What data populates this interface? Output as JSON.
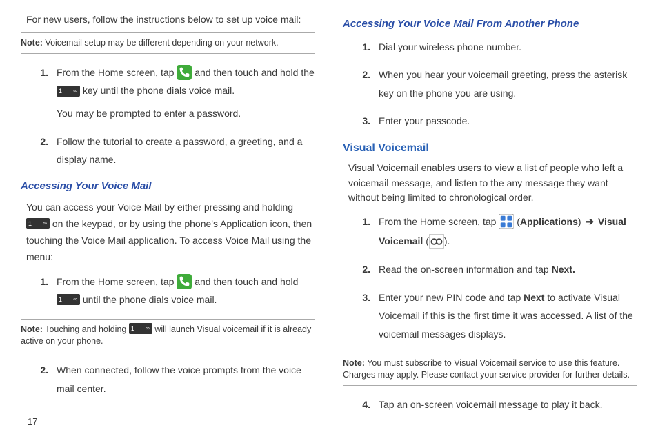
{
  "pageNumber": "17",
  "left": {
    "intro": "For new users, follow the instructions below to set up voice mail:",
    "note1": {
      "label": "Note:",
      "text": " Voicemail setup may be different depending on your network."
    },
    "setup": {
      "s1a": "From the Home screen, tap ",
      "s1b": " and then touch and hold the ",
      "s1c": " key until the phone dials voice mail.",
      "s1sub": "You may be prompted to enter a password.",
      "s2": "Follow the tutorial to create a password, a greeting, and a display name."
    },
    "accessHeading": "Accessing Your Voice Mail",
    "accessPara_a": "You can access your Voice Mail by either pressing and holding ",
    "accessPara_b": " on the keypad, or by using the phone's Application icon, then touching the Voice Mail application. To access Voice Mail using the menu:",
    "access": {
      "s1a": "From the Home screen, tap ",
      "s1b": " and then touch and hold ",
      "s1c": " until the phone dials voice mail."
    },
    "note2": {
      "label": "Note:",
      "text_a": " Touching and holding ",
      "text_b": " will launch Visual voicemail if it is already active on your phone."
    },
    "access2": "When connected, follow the voice prompts from the voice mail center."
  },
  "right": {
    "anotherHeading": "Accessing Your Voice Mail From Another Phone",
    "another": {
      "s1": "Dial your wireless phone number.",
      "s2": "When you hear your voicemail greeting, press the asterisk key on the phone you are using.",
      "s3": "Enter your passcode."
    },
    "vvHeading": "Visual Voicemail",
    "vvPara": "Visual Voicemail enables users to view a list of people who left a voicemail message, and listen to the any message they want without being limited to chronological order.",
    "vv": {
      "s1a": "From the Home screen, tap ",
      "s1b": " (",
      "s1_apps": "Applications",
      "s1c": ") ",
      "s1_arrow": "➔",
      "s1d": " ",
      "s1_vv": "Visual Voicemail",
      "s1e": " (",
      "s1f": ").",
      "s2a": "Read the on-screen information and tap ",
      "s2_next": "Next.",
      "s3a": "Enter your new PIN code and tap ",
      "s3_next": "Next",
      "s3b": " to activate Visual Voicemail if this is the first time it was accessed. A list of the voicemail messages displays."
    },
    "note3": {
      "label": "Note:",
      "text": " You must subscribe to Visual Voicemail service to use this feature. Charges may apply. Please contact your service provider for further details."
    },
    "vv4": "Tap an on-screen voicemail message to play it back."
  },
  "nums": {
    "n1": "1.",
    "n2": "2.",
    "n3": "3.",
    "n4": "4."
  },
  "keyLabel": "1"
}
